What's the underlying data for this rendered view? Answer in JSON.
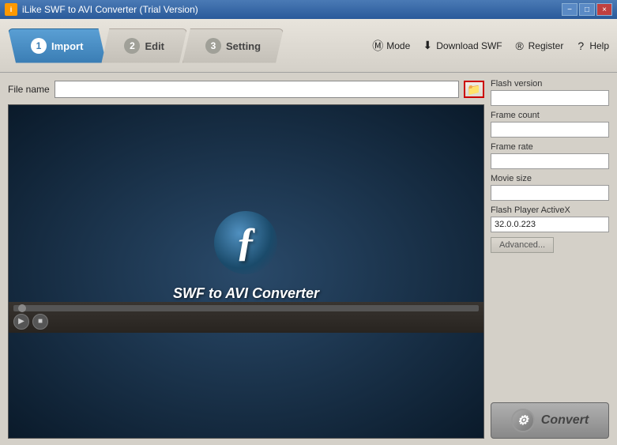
{
  "titlebar": {
    "title": "iLike SWF to AVI Converter (Trial Version)",
    "minimize": "−",
    "maximize": "□",
    "close": "×"
  },
  "tabs": [
    {
      "id": "import",
      "number": "1",
      "label": "Import",
      "active": true
    },
    {
      "id": "edit",
      "number": "2",
      "label": "Edit",
      "active": false
    },
    {
      "id": "setting",
      "number": "3",
      "label": "Setting",
      "active": false
    }
  ],
  "toolbar_right": [
    {
      "id": "mode",
      "icon": "M",
      "label": "Mode"
    },
    {
      "id": "download",
      "icon": "⬇",
      "label": "Download SWF"
    },
    {
      "id": "register",
      "icon": "®",
      "label": "Register"
    },
    {
      "id": "help",
      "icon": "?",
      "label": "Help"
    }
  ],
  "file_name": {
    "label": "File name",
    "value": "",
    "placeholder": ""
  },
  "video": {
    "flash_title": "SWF to AVI Converter"
  },
  "right_panel": {
    "flash_version": {
      "label": "Flash version",
      "value": ""
    },
    "frame_count": {
      "label": "Frame count",
      "value": ""
    },
    "frame_rate": {
      "label": "Frame rate",
      "value": ""
    },
    "movie_size": {
      "label": "Movie size",
      "value": ""
    },
    "flash_player": {
      "label": "Flash Player ActiveX",
      "value": "32.0.0.223"
    },
    "advanced_btn": "Advanced...",
    "convert_btn": "Convert"
  }
}
